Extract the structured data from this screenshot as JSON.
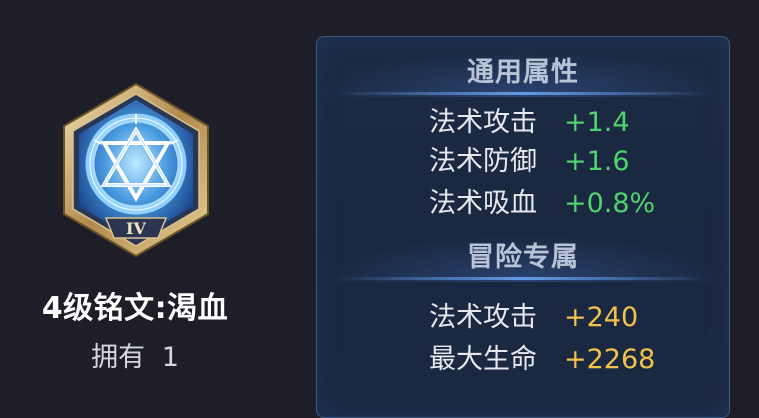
{
  "rune": {
    "title": "4级铭文:渴血",
    "own_label": "拥有",
    "own_count": "1",
    "level_numeral": "IV"
  },
  "panel": {
    "sections": [
      {
        "header": "通用属性",
        "stats": [
          {
            "label": "法术攻击",
            "value": "+1.4"
          },
          {
            "label": "法术防御",
            "value": "+1.6"
          },
          {
            "label": "法术吸血",
            "value": "+0.8%"
          }
        ]
      },
      {
        "header": "冒险专属",
        "stats": [
          {
            "label": "法术攻击",
            "value": "+240"
          },
          {
            "label": "最大生命",
            "value": "+2268"
          }
        ]
      }
    ]
  },
  "colors": {
    "background": "#1e1e29",
    "panel": "#1c2a44",
    "common_value": "#4fd36e",
    "adventure_value": "#f2c24a"
  }
}
